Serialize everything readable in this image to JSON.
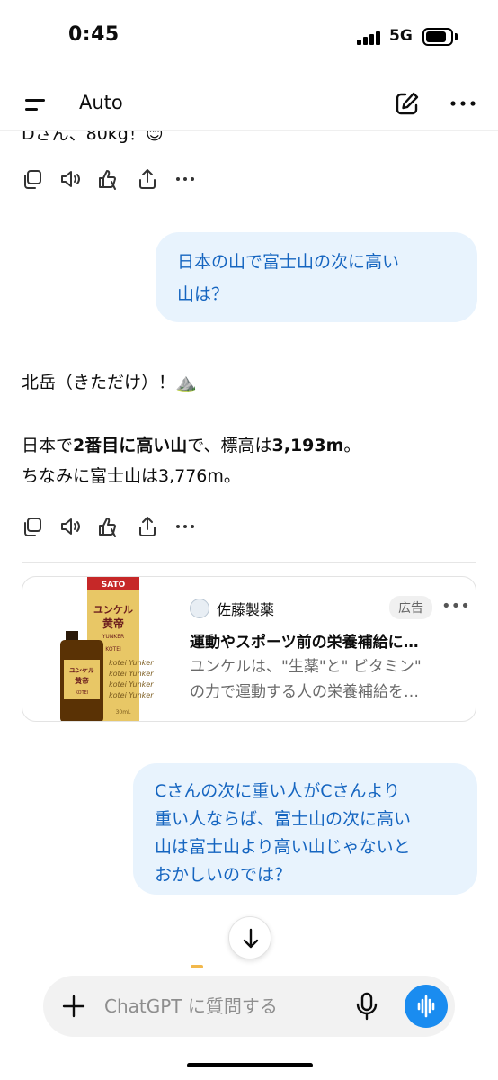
{
  "status_bar": {
    "time": "0:45",
    "network": "5G"
  },
  "header": {
    "model": "Auto",
    "icons": [
      "menu-icon",
      "new-chat-icon",
      "more-icon"
    ]
  },
  "conversation": {
    "partial_top_text": "Dさん、80kg！😊",
    "action_icons": [
      "copy-icon",
      "read-aloud-icon",
      "thumbs-feedback-icon",
      "share-icon",
      "more-icon"
    ],
    "user_message_1": {
      "line1": "日本の山で富士山の次に高い",
      "line2": "山は？"
    },
    "assistant_reply": {
      "line1": "北岳（きただけ）！⛰️",
      "line2_pre": "日本で",
      "line2_bold": "2番目に高い山",
      "line2_mid": "で、標高は",
      "line2_value": "3,193m",
      "line2_post": "。",
      "line3": "ちなみに富士山は3,776m。"
    },
    "ad": {
      "brand": "佐藤製薬",
      "badge": "広告",
      "title": "運動やスポーツ前の栄養補給に…",
      "desc_line1": "ユンケルは、\"生薬\"と\" ビタミン\"",
      "desc_line2": "の力で運動する人の栄養補給を…",
      "image_text_top": "ユンケル",
      "image_text_name": "黄帝",
      "image_text_brand": "SATO",
      "image_text_latin": "YUNKER",
      "image_text_sub": "KOTEI",
      "image_text_pattern": "kotei Yunker",
      "image_text_volume": "30mL"
    },
    "user_message_2": {
      "line1": "Cさんの次に重い人がCさんより",
      "line2": "重い人ならば、富士山の次に高い",
      "line3": "山は富士山より高い山じゃないと",
      "line4": "おかしいのでは？"
    }
  },
  "composer": {
    "placeholder": "ChatGPT に質問する",
    "value": ""
  },
  "colors": {
    "user_bubble_bg": "#e8f3fd",
    "user_bubble_text": "#1565c0",
    "voice_button": "#1a8cf0"
  }
}
